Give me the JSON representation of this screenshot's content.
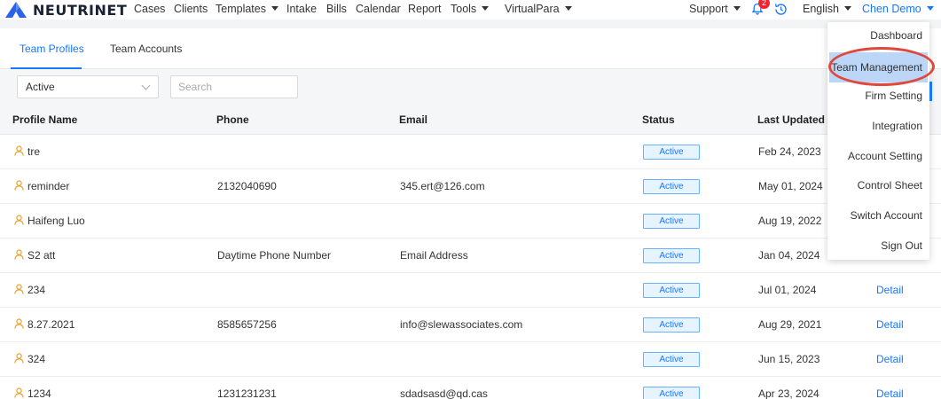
{
  "brand": {
    "name": "NEUTRINET"
  },
  "nav": {
    "items": [
      {
        "label": "Cases",
        "caret": false
      },
      {
        "label": "Clients",
        "caret": false
      },
      {
        "label": "Templates",
        "caret": true
      },
      {
        "label": "Intake",
        "caret": false
      },
      {
        "label": "Bills",
        "caret": false
      },
      {
        "label": "Calendar",
        "caret": false
      },
      {
        "label": "Report",
        "caret": false
      },
      {
        "label": "Tools",
        "caret": true
      },
      {
        "label": "VirtualPara",
        "caret": true
      }
    ],
    "support_label": "Support",
    "notification_count": "2",
    "language_label": "English",
    "user_label": "Chen Demo"
  },
  "tabs": [
    {
      "label": "Team Profiles",
      "active": true
    },
    {
      "label": "Team Accounts",
      "active": false
    }
  ],
  "filters": {
    "status_value": "Active",
    "search_placeholder": "Search"
  },
  "table": {
    "columns": [
      "Profile Name",
      "Phone",
      "Email",
      "Status",
      "Last Updated"
    ],
    "rows": [
      {
        "name": "tre",
        "phone": "",
        "email": "",
        "status": "Active",
        "updated": "Feb 24, 2023",
        "action": ""
      },
      {
        "name": "reminder",
        "phone": "2132040690",
        "email": "345.ert@126.com",
        "status": "Active",
        "updated": "May 01, 2024",
        "action": ""
      },
      {
        "name": "Haifeng Luo",
        "phone": "",
        "email": "",
        "status": "Active",
        "updated": "Aug 19, 2022",
        "action": ""
      },
      {
        "name": "S2 att",
        "phone": "Daytime Phone Number",
        "email": "Email Address",
        "status": "Active",
        "updated": "Jan 04, 2024",
        "action": ""
      },
      {
        "name": "234",
        "phone": "",
        "email": "",
        "status": "Active",
        "updated": "Jul 01, 2024",
        "action": "Detail"
      },
      {
        "name": "8.27.2021",
        "phone": "8585657256",
        "email": "info@slewassociates.com",
        "status": "Active",
        "updated": "Aug 29, 2021",
        "action": "Detail"
      },
      {
        "name": "324",
        "phone": "",
        "email": "",
        "status": "Active",
        "updated": "Jun 15, 2023",
        "action": "Detail"
      },
      {
        "name": "1234",
        "phone": "1231231231",
        "email": "sdadsasd@qd.cas",
        "status": "Active",
        "updated": "Apr 23, 2024",
        "action": "Detail"
      }
    ]
  },
  "user_menu": {
    "items": [
      "Dashboard",
      "Team Management",
      "Firm Setting",
      "Integration",
      "Account Setting",
      "Control Sheet",
      "Switch Account",
      "Sign Out"
    ],
    "highlighted": "Team Management"
  },
  "colors": {
    "accent": "#1677ff",
    "person_icon": "#f0a020",
    "badge": "#f5222d",
    "annotation_circle": "#e0483e",
    "menu_highlight": "#bcd6f7"
  }
}
